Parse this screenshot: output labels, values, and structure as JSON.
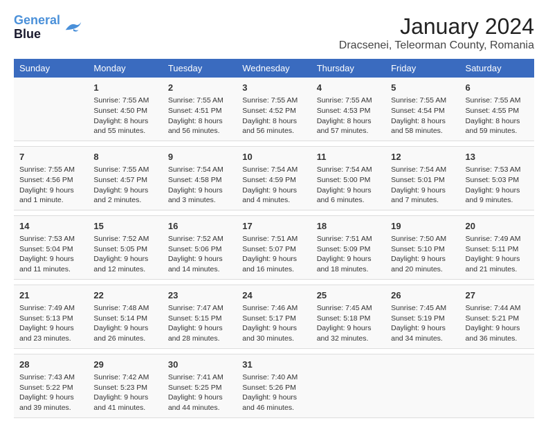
{
  "header": {
    "logo_line1": "General",
    "logo_line2": "Blue",
    "title": "January 2024",
    "subtitle": "Dracsenei, Teleorman County, Romania"
  },
  "days_of_week": [
    "Sunday",
    "Monday",
    "Tuesday",
    "Wednesday",
    "Thursday",
    "Friday",
    "Saturday"
  ],
  "weeks": [
    [
      {
        "num": "",
        "sunrise": "",
        "sunset": "",
        "daylight": ""
      },
      {
        "num": "1",
        "sunrise": "Sunrise: 7:55 AM",
        "sunset": "Sunset: 4:50 PM",
        "daylight": "Daylight: 8 hours and 55 minutes."
      },
      {
        "num": "2",
        "sunrise": "Sunrise: 7:55 AM",
        "sunset": "Sunset: 4:51 PM",
        "daylight": "Daylight: 8 hours and 56 minutes."
      },
      {
        "num": "3",
        "sunrise": "Sunrise: 7:55 AM",
        "sunset": "Sunset: 4:52 PM",
        "daylight": "Daylight: 8 hours and 56 minutes."
      },
      {
        "num": "4",
        "sunrise": "Sunrise: 7:55 AM",
        "sunset": "Sunset: 4:53 PM",
        "daylight": "Daylight: 8 hours and 57 minutes."
      },
      {
        "num": "5",
        "sunrise": "Sunrise: 7:55 AM",
        "sunset": "Sunset: 4:54 PM",
        "daylight": "Daylight: 8 hours and 58 minutes."
      },
      {
        "num": "6",
        "sunrise": "Sunrise: 7:55 AM",
        "sunset": "Sunset: 4:55 PM",
        "daylight": "Daylight: 8 hours and 59 minutes."
      }
    ],
    [
      {
        "num": "7",
        "sunrise": "Sunrise: 7:55 AM",
        "sunset": "Sunset: 4:56 PM",
        "daylight": "Daylight: 9 hours and 1 minute."
      },
      {
        "num": "8",
        "sunrise": "Sunrise: 7:55 AM",
        "sunset": "Sunset: 4:57 PM",
        "daylight": "Daylight: 9 hours and 2 minutes."
      },
      {
        "num": "9",
        "sunrise": "Sunrise: 7:54 AM",
        "sunset": "Sunset: 4:58 PM",
        "daylight": "Daylight: 9 hours and 3 minutes."
      },
      {
        "num": "10",
        "sunrise": "Sunrise: 7:54 AM",
        "sunset": "Sunset: 4:59 PM",
        "daylight": "Daylight: 9 hours and 4 minutes."
      },
      {
        "num": "11",
        "sunrise": "Sunrise: 7:54 AM",
        "sunset": "Sunset: 5:00 PM",
        "daylight": "Daylight: 9 hours and 6 minutes."
      },
      {
        "num": "12",
        "sunrise": "Sunrise: 7:54 AM",
        "sunset": "Sunset: 5:01 PM",
        "daylight": "Daylight: 9 hours and 7 minutes."
      },
      {
        "num": "13",
        "sunrise": "Sunrise: 7:53 AM",
        "sunset": "Sunset: 5:03 PM",
        "daylight": "Daylight: 9 hours and 9 minutes."
      }
    ],
    [
      {
        "num": "14",
        "sunrise": "Sunrise: 7:53 AM",
        "sunset": "Sunset: 5:04 PM",
        "daylight": "Daylight: 9 hours and 11 minutes."
      },
      {
        "num": "15",
        "sunrise": "Sunrise: 7:52 AM",
        "sunset": "Sunset: 5:05 PM",
        "daylight": "Daylight: 9 hours and 12 minutes."
      },
      {
        "num": "16",
        "sunrise": "Sunrise: 7:52 AM",
        "sunset": "Sunset: 5:06 PM",
        "daylight": "Daylight: 9 hours and 14 minutes."
      },
      {
        "num": "17",
        "sunrise": "Sunrise: 7:51 AM",
        "sunset": "Sunset: 5:07 PM",
        "daylight": "Daylight: 9 hours and 16 minutes."
      },
      {
        "num": "18",
        "sunrise": "Sunrise: 7:51 AM",
        "sunset": "Sunset: 5:09 PM",
        "daylight": "Daylight: 9 hours and 18 minutes."
      },
      {
        "num": "19",
        "sunrise": "Sunrise: 7:50 AM",
        "sunset": "Sunset: 5:10 PM",
        "daylight": "Daylight: 9 hours and 20 minutes."
      },
      {
        "num": "20",
        "sunrise": "Sunrise: 7:49 AM",
        "sunset": "Sunset: 5:11 PM",
        "daylight": "Daylight: 9 hours and 21 minutes."
      }
    ],
    [
      {
        "num": "21",
        "sunrise": "Sunrise: 7:49 AM",
        "sunset": "Sunset: 5:13 PM",
        "daylight": "Daylight: 9 hours and 23 minutes."
      },
      {
        "num": "22",
        "sunrise": "Sunrise: 7:48 AM",
        "sunset": "Sunset: 5:14 PM",
        "daylight": "Daylight: 9 hours and 26 minutes."
      },
      {
        "num": "23",
        "sunrise": "Sunrise: 7:47 AM",
        "sunset": "Sunset: 5:15 PM",
        "daylight": "Daylight: 9 hours and 28 minutes."
      },
      {
        "num": "24",
        "sunrise": "Sunrise: 7:46 AM",
        "sunset": "Sunset: 5:17 PM",
        "daylight": "Daylight: 9 hours and 30 minutes."
      },
      {
        "num": "25",
        "sunrise": "Sunrise: 7:45 AM",
        "sunset": "Sunset: 5:18 PM",
        "daylight": "Daylight: 9 hours and 32 minutes."
      },
      {
        "num": "26",
        "sunrise": "Sunrise: 7:45 AM",
        "sunset": "Sunset: 5:19 PM",
        "daylight": "Daylight: 9 hours and 34 minutes."
      },
      {
        "num": "27",
        "sunrise": "Sunrise: 7:44 AM",
        "sunset": "Sunset: 5:21 PM",
        "daylight": "Daylight: 9 hours and 36 minutes."
      }
    ],
    [
      {
        "num": "28",
        "sunrise": "Sunrise: 7:43 AM",
        "sunset": "Sunset: 5:22 PM",
        "daylight": "Daylight: 9 hours and 39 minutes."
      },
      {
        "num": "29",
        "sunrise": "Sunrise: 7:42 AM",
        "sunset": "Sunset: 5:23 PM",
        "daylight": "Daylight: 9 hours and 41 minutes."
      },
      {
        "num": "30",
        "sunrise": "Sunrise: 7:41 AM",
        "sunset": "Sunset: 5:25 PM",
        "daylight": "Daylight: 9 hours and 44 minutes."
      },
      {
        "num": "31",
        "sunrise": "Sunrise: 7:40 AM",
        "sunset": "Sunset: 5:26 PM",
        "daylight": "Daylight: 9 hours and 46 minutes."
      },
      {
        "num": "",
        "sunrise": "",
        "sunset": "",
        "daylight": ""
      },
      {
        "num": "",
        "sunrise": "",
        "sunset": "",
        "daylight": ""
      },
      {
        "num": "",
        "sunrise": "",
        "sunset": "",
        "daylight": ""
      }
    ]
  ]
}
